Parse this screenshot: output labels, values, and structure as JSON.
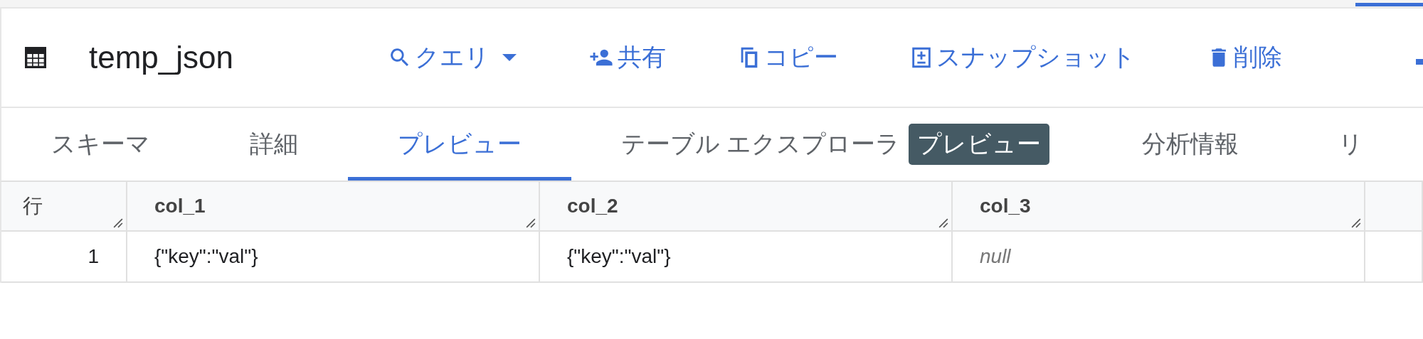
{
  "table_title": "temp_json",
  "actions": [
    {
      "label": "クエリ",
      "kind": "query"
    },
    {
      "label": "共有",
      "kind": "share"
    },
    {
      "label": "コピー",
      "kind": "copy"
    },
    {
      "label": "スナップショット",
      "kind": "snapshot"
    },
    {
      "label": "削除",
      "kind": "delete"
    }
  ],
  "tabs": [
    {
      "label": "スキーマ",
      "selected": false
    },
    {
      "label": "詳細",
      "selected": false
    },
    {
      "label": "プレビュー",
      "selected": true
    },
    {
      "label": "テーブル エクスプローラ",
      "selected": false,
      "badge": "プレビュー"
    },
    {
      "label": "分析情報",
      "selected": false
    },
    {
      "label": "リ",
      "selected": false
    }
  ],
  "table": {
    "columns": [
      "行",
      "col_1",
      "col_2",
      "col_3"
    ],
    "rows": [
      {
        "cells": [
          {
            "text": "1",
            "kind": "number"
          },
          {
            "text": "{\"key\":\"val\"}",
            "kind": "value"
          },
          {
            "text": "{\"key\":\"val\"}",
            "kind": "value"
          },
          {
            "text": "null",
            "kind": "null"
          }
        ]
      }
    ]
  }
}
